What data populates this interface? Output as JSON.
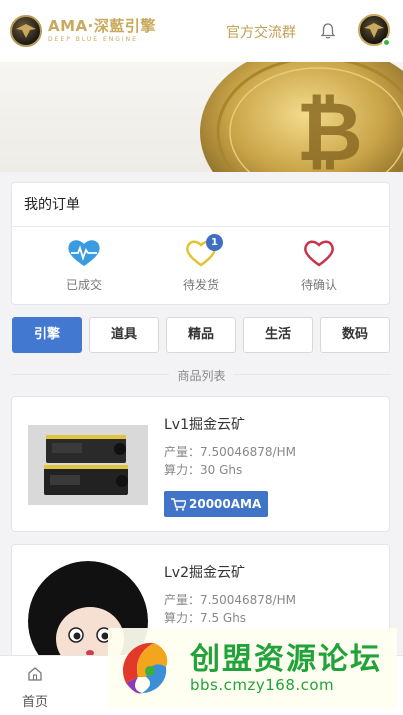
{
  "header": {
    "logo_main": "AMA·深藍引擎",
    "logo_sub": "DEEP BLUE ENGINE",
    "group_link": "官方交流群"
  },
  "orders": {
    "title": "我的订单",
    "items": [
      {
        "label": "已成交",
        "icon": "heartbeat-icon",
        "badge": ""
      },
      {
        "label": "待发货",
        "icon": "heart-pending-icon",
        "badge": "1"
      },
      {
        "label": "待确认",
        "icon": "heart-outline-icon",
        "badge": ""
      }
    ]
  },
  "tabs": [
    "引擎",
    "道具",
    "精品",
    "生活",
    "数码"
  ],
  "active_tab": "引擎",
  "section_title": "商品列表",
  "products": [
    {
      "name": "Lv1掘金云矿",
      "output": "产量：7.50046878/HM",
      "power": "算力：30 Ghs",
      "price": "20000AMA"
    },
    {
      "name": "Lv2掘金云矿",
      "output": "产量：7.50046878/HM",
      "power": "算力：7.5 Ghs"
    }
  ],
  "bottom_nav": [
    {
      "label": "首页",
      "icon": "home-icon"
    }
  ],
  "watermark": {
    "main": "创盟资源论坛",
    "url": "bbs.cmzy168.com"
  },
  "colors": {
    "accent": "#4278cf",
    "gold": "#c2a055",
    "watermark_green": "#22a33a"
  }
}
